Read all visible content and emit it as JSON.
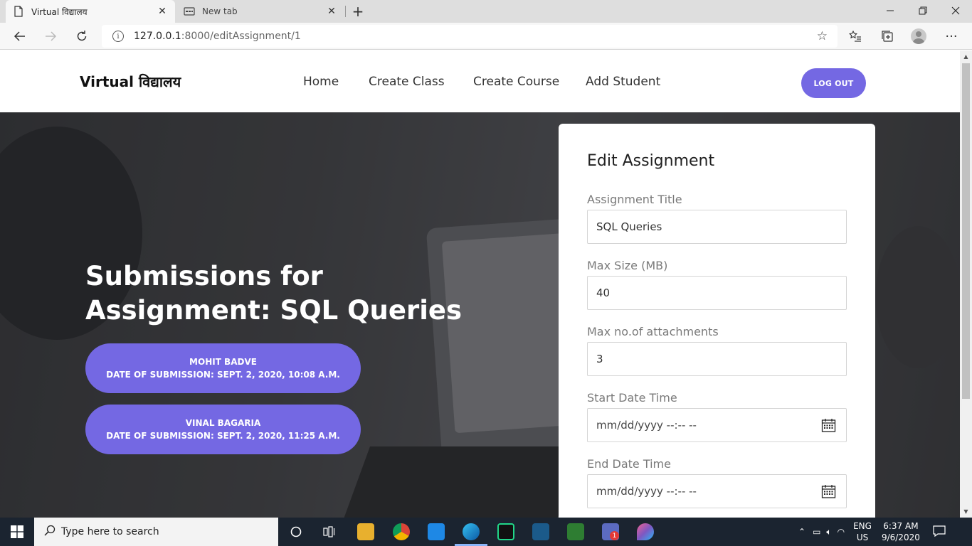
{
  "browser": {
    "tabs": [
      {
        "title": "Virtual विद्यालय",
        "active": true
      },
      {
        "title": "New tab",
        "active": false
      }
    ],
    "url_host": "127.0.0.1",
    "url_path": ":8000/editAssignment/1"
  },
  "site": {
    "logo": "Virtual विद्यालय",
    "nav": [
      "Home",
      "Create Class",
      "Create Course",
      "Add Student"
    ],
    "logout_label": "LOG OUT"
  },
  "hero": {
    "title": "Submissions for Assignment: SQL Queries",
    "submissions": [
      {
        "name": "MOHIT BADVE",
        "date": "DATE OF SUBMISSION: SEPT. 2, 2020, 10:08 A.M."
      },
      {
        "name": "VINAL BAGARIA",
        "date": "DATE OF SUBMISSION: SEPT. 2, 2020, 11:25 A.M."
      }
    ]
  },
  "form": {
    "title": "Edit Assignment",
    "fields": [
      {
        "label": "Assignment Title",
        "value": "SQL Queries"
      },
      {
        "label": "Max Size (MB)",
        "value": "40"
      },
      {
        "label": "Max no.of attachments",
        "value": "3"
      },
      {
        "label": "Start Date Time",
        "placeholder": "mm/dd/yyyy --:-- --"
      },
      {
        "label": "End Date Time",
        "placeholder": "mm/dd/yyyy --:-- --"
      }
    ]
  },
  "taskbar": {
    "search_placeholder": "Type here to search",
    "language": "ENG",
    "region": "US",
    "time": "6:37 AM",
    "date": "9/6/2020",
    "notification_badge": "1"
  },
  "colors": {
    "accent": "#7468e3",
    "taskbar": "#1b2430"
  }
}
